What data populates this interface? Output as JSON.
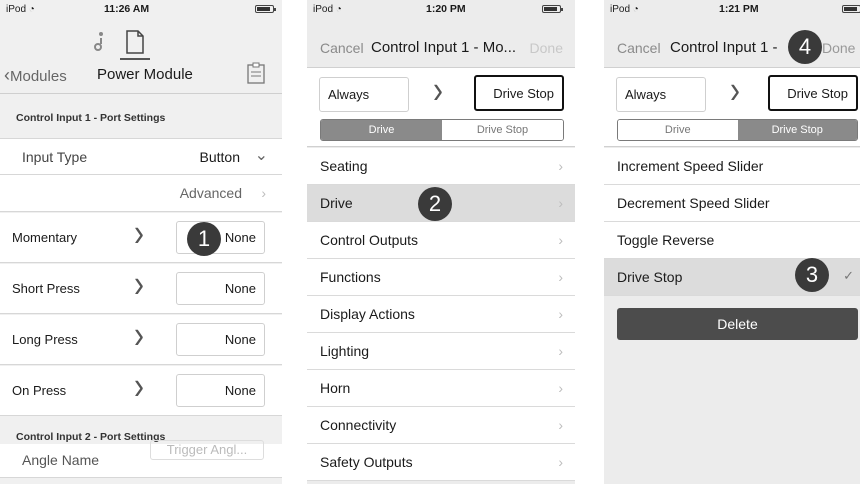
{
  "screen1": {
    "status": {
      "carrier": "iPod",
      "time": "11:26 AM"
    },
    "nav": {
      "back_label": "Modules",
      "title": "Power Module"
    },
    "section1_header": "Control Input 1 - Port Settings",
    "input_type": {
      "label": "Input Type",
      "value": "Button"
    },
    "advanced_label": "Advanced",
    "press_rows": [
      {
        "label": "Momentary",
        "value": "None"
      },
      {
        "label": "Short Press",
        "value": "None"
      },
      {
        "label": "Long Press",
        "value": "None"
      },
      {
        "label": "On Press",
        "value": "None"
      }
    ],
    "section2_header": "Control Input 2 - Port Settings",
    "angle_name": {
      "label": "Angle Name",
      "placeholder": "Trigger Angl..."
    },
    "badge": "1"
  },
  "screen2": {
    "status": {
      "carrier": "iPod",
      "time": "1:20 PM"
    },
    "nav": {
      "cancel": "Cancel",
      "title": "Control Input 1 - Mo...",
      "done": "Done"
    },
    "mapping": {
      "from": "Always",
      "to": "Drive Stop"
    },
    "segments": {
      "left": "Drive",
      "right": "Drive Stop"
    },
    "menu_items": [
      "Seating",
      "Drive",
      "Control Outputs",
      "Functions",
      "Display Actions",
      "Lighting",
      "Horn",
      "Connectivity",
      "Safety Outputs"
    ],
    "badge": "2"
  },
  "screen3": {
    "status": {
      "carrier": "iPod",
      "time": "1:21 PM"
    },
    "nav": {
      "cancel": "Cancel",
      "title": "Control Input 1 -",
      "done": "Done"
    },
    "mapping": {
      "from": "Always",
      "to": "Drive Stop"
    },
    "segments": {
      "left": "Drive",
      "right": "Drive Stop"
    },
    "options": [
      "Increment Speed Slider",
      "Decrement Speed Slider",
      "Toggle Reverse",
      "Drive Stop"
    ],
    "checkmark": "✓",
    "delete_label": "Delete",
    "badge3": "3",
    "badge4": "4"
  }
}
